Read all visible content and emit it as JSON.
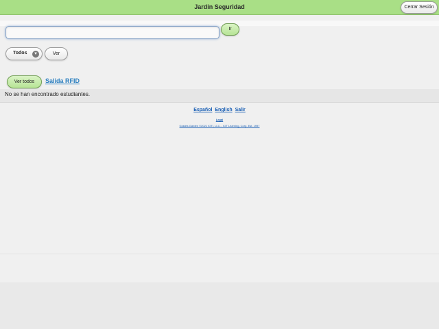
{
  "header": {
    "title": "Jardin Seguridad",
    "logout_label": "Cerrar Sesión"
  },
  "search": {
    "value": "",
    "placeholder": "",
    "go_label": "Ir"
  },
  "filter": {
    "selected": "Todos",
    "view_label": "Ver"
  },
  "actions": {
    "view_all_label": "Ver todos",
    "rfid_link": "Salida RFID"
  },
  "results": {
    "empty_message": "No se han encontrado estudiantes."
  },
  "footer": {
    "languages": [
      "Español",
      "English",
      "Salir"
    ],
    "legal_label": "Legal",
    "copyright": "Grades Garden ©2021 IOTI, LLC. - IOT Learning, Corp. Est. 1997"
  },
  "colors": {
    "header_bg": "#a9df86",
    "link": "#1a5fb4",
    "page_bg": "#f0f0f0"
  },
  "icons": {
    "filter_chevron": "chevron-down-icon"
  }
}
